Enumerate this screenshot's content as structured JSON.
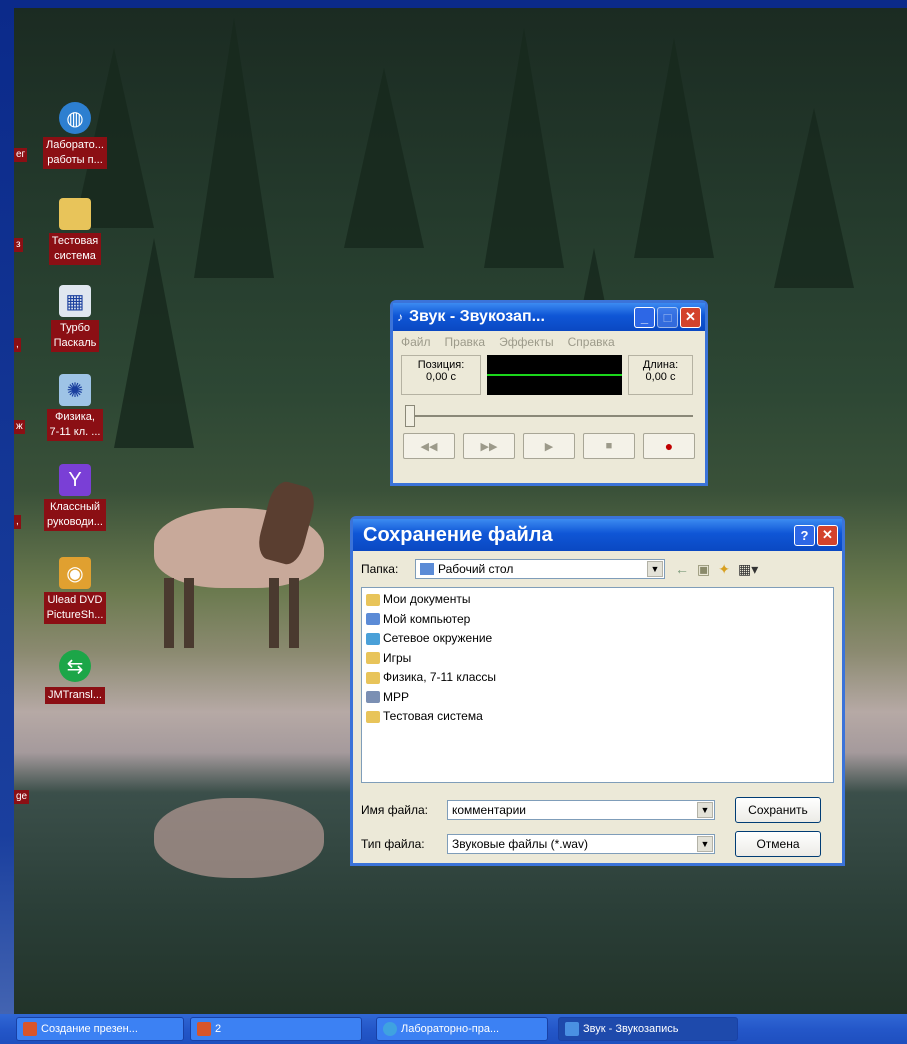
{
  "desktop": {
    "icons": [
      {
        "label_line1": "Лаборато...",
        "label_line2": "работы п...",
        "icon": "globe-icon"
      },
      {
        "label_line1": "Тестовая",
        "label_line2": "система",
        "icon": "folder-icon"
      },
      {
        "label_line1": "Турбо",
        "label_line2": "Паскаль",
        "icon": "app-icon"
      },
      {
        "label_line1": "Физика,",
        "label_line2": "7-11 кл. ...",
        "icon": "atom-icon"
      },
      {
        "label_line1": "Классный",
        "label_line2": "руководи...",
        "icon": "y-icon"
      },
      {
        "label_line1": "Ulead DVD",
        "label_line2": "PictureSh...",
        "icon": "dvd-icon"
      },
      {
        "label_line1": "JMTransl...",
        "label_line2": "",
        "icon": "translate-icon"
      }
    ],
    "side_fragments": [
      "ег",
      "з",
      ",",
      "ж",
      ",",
      "",
      "ge"
    ]
  },
  "recorder": {
    "title": "Звук - Звукозап...",
    "menu": [
      "Файл",
      "Правка",
      "Эффекты",
      "Справка"
    ],
    "position_label": "Позиция:",
    "position_value": "0,00 с",
    "length_label": "Длина:",
    "length_value": "0,00 с",
    "buttons": [
      "◀◀",
      "▶▶",
      "▶",
      "■",
      "●"
    ]
  },
  "save_dialog": {
    "title": "Сохранение файла",
    "help": "?",
    "folder_label": "Папка:",
    "folder_value": "Рабочий стол",
    "items": [
      {
        "name": "Мои документы",
        "icon": "folder-icon",
        "color": "#e8c45a"
      },
      {
        "name": "Мой компьютер",
        "icon": "computer-icon",
        "color": "#5b8bd6"
      },
      {
        "name": "Сетевое окружение",
        "icon": "network-icon",
        "color": "#4aa0d8"
      },
      {
        "name": "Игры",
        "icon": "folder-icon",
        "color": "#e8c45a"
      },
      {
        "name": "Физика, 7-11 классы",
        "icon": "folder-icon",
        "color": "#e8c45a"
      },
      {
        "name": "MPP",
        "icon": "drive-icon",
        "color": "#7b8fb3"
      },
      {
        "name": "Тестовая система",
        "icon": "folder-icon",
        "color": "#e8c45a"
      }
    ],
    "filename_label": "Имя файла:",
    "filename_value": "комментарии",
    "filetype_label": "Тип файла:",
    "filetype_value": "Звуковые файлы (*.wav)",
    "save_button": "Сохранить",
    "cancel_button": "Отмена"
  },
  "taskbar": {
    "tasks": [
      {
        "label": "Создание презен...",
        "color": "#d8552b"
      },
      {
        "label": "2",
        "color": "#d8552b"
      },
      {
        "label": "Лабораторно-пра...",
        "color": "#3fa2e0"
      },
      {
        "label": "Звук - Звукозапись",
        "color": "#4a90e2"
      }
    ]
  }
}
